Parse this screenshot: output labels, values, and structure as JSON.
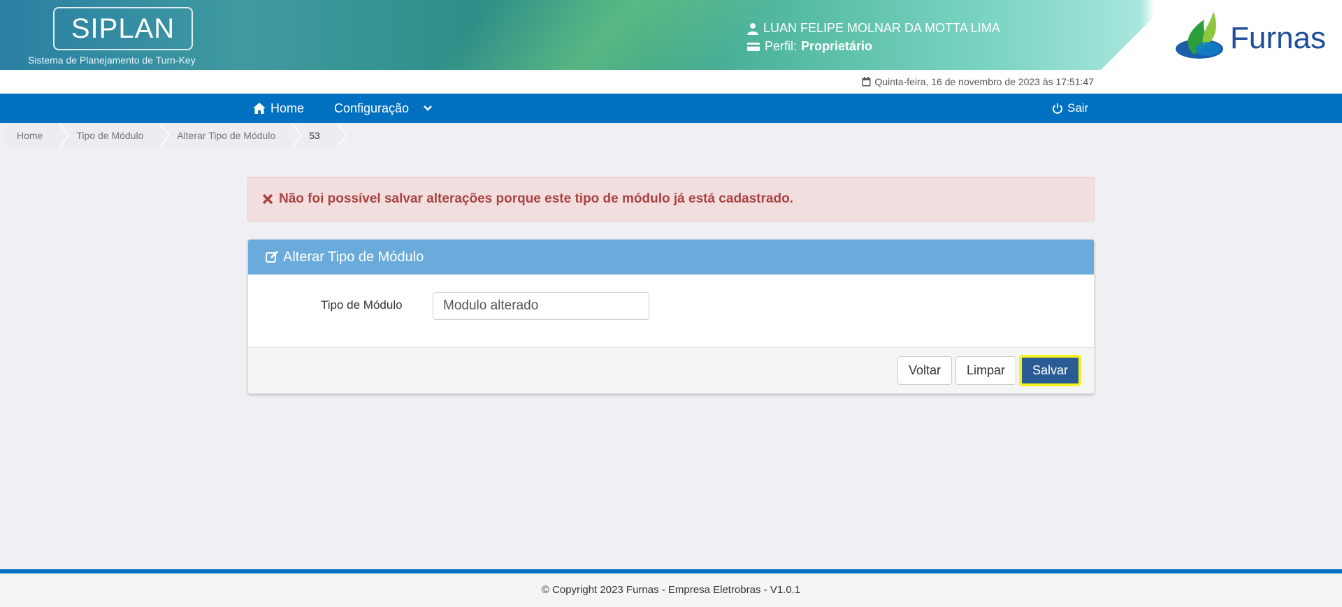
{
  "header": {
    "logo_text": "SIPLAN",
    "logo_subtitle": "Sistema de Planejamento de Turn-Key",
    "user_name": "LUAN FELIPE MOLNAR DA MOTTA LIMA",
    "perfil_label": "Perfil:",
    "perfil_value": "Proprietário",
    "brand_name": "Furnas",
    "user_icon": "user-icon",
    "perfil_icon": "id-card-icon"
  },
  "date_row": {
    "text": "Quinta-feira, 16 de novembro de 2023 às 17:51:47",
    "icon": "calendar-icon"
  },
  "nav": {
    "home": "Home",
    "config": "Configuração",
    "sair": "Sair",
    "color": "#0070c0"
  },
  "breadcrumb": [
    "Home",
    "Tipo de Módulo",
    "Alterar Tipo de Módulo",
    "53"
  ],
  "alert": {
    "message": "Não foi possível salvar alterações porque este tipo de módulo já está cadastrado.",
    "icon": "times-icon",
    "color": "#a94442"
  },
  "panel": {
    "title": "Alterar Tipo de Módulo",
    "title_icon": "edit-icon",
    "field_label": "Tipo de Módulo",
    "field_value": "Modulo alterado",
    "buttons": {
      "voltar": "Voltar",
      "limpar": "Limpar",
      "salvar": "Salvar"
    }
  },
  "footer": {
    "text": "© Copyright 2023 Furnas - Empresa Eletrobras - V1.0.1"
  }
}
